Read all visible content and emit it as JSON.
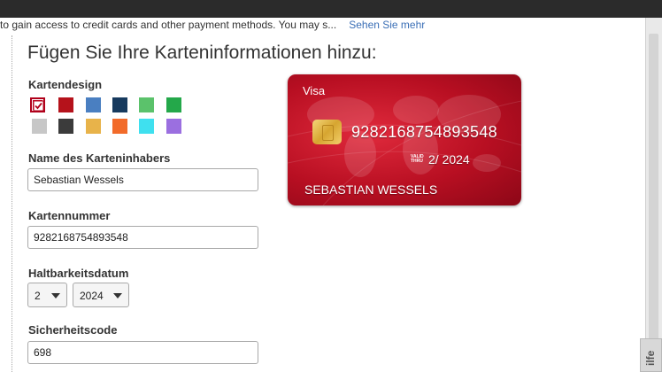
{
  "notice": {
    "text": "to gain access to credit cards and other payment methods. You may s...",
    "more_link": "Sehen Sie mehr"
  },
  "heading": "Fügen Sie Ihre Karteninformationen hinzu:",
  "card_design": {
    "label": "Kartendesign",
    "selected": "red",
    "swatches": [
      {
        "name": "red",
        "color": "#c8102e"
      },
      {
        "name": "dark-red",
        "color": "#b5121b"
      },
      {
        "name": "blue",
        "color": "#4a7fc1"
      },
      {
        "name": "navy",
        "color": "#173a5e"
      },
      {
        "name": "light-green",
        "color": "#5bc26b"
      },
      {
        "name": "green",
        "color": "#24a84a"
      },
      {
        "name": "light-gray",
        "color": "#c7c7c7"
      },
      {
        "name": "charcoal",
        "color": "#3b3b3b"
      },
      {
        "name": "gold",
        "color": "#e8b34a"
      },
      {
        "name": "orange",
        "color": "#f26b2a"
      },
      {
        "name": "cyan",
        "color": "#3fe0ef"
      },
      {
        "name": "purple",
        "color": "#9b6fe0"
      }
    ]
  },
  "holder": {
    "label": "Name des Karteninhabers",
    "value": "Sebastian Wessels"
  },
  "number": {
    "label": "Kartennummer",
    "value": "9282168754893548"
  },
  "expiry": {
    "label": "Haltbarkeitsdatum",
    "month": "2",
    "year": "2024"
  },
  "cvc": {
    "label": "Sicherheitscode",
    "value": "698"
  },
  "card_preview": {
    "brand": "Visa",
    "number": "9282168754893548",
    "valid_thru": "VALID THRU",
    "expiry": "2/ 2024",
    "holder": "SEBASTIAN WESSELS",
    "color": "#c8102e"
  },
  "help_tab": "ilfe"
}
